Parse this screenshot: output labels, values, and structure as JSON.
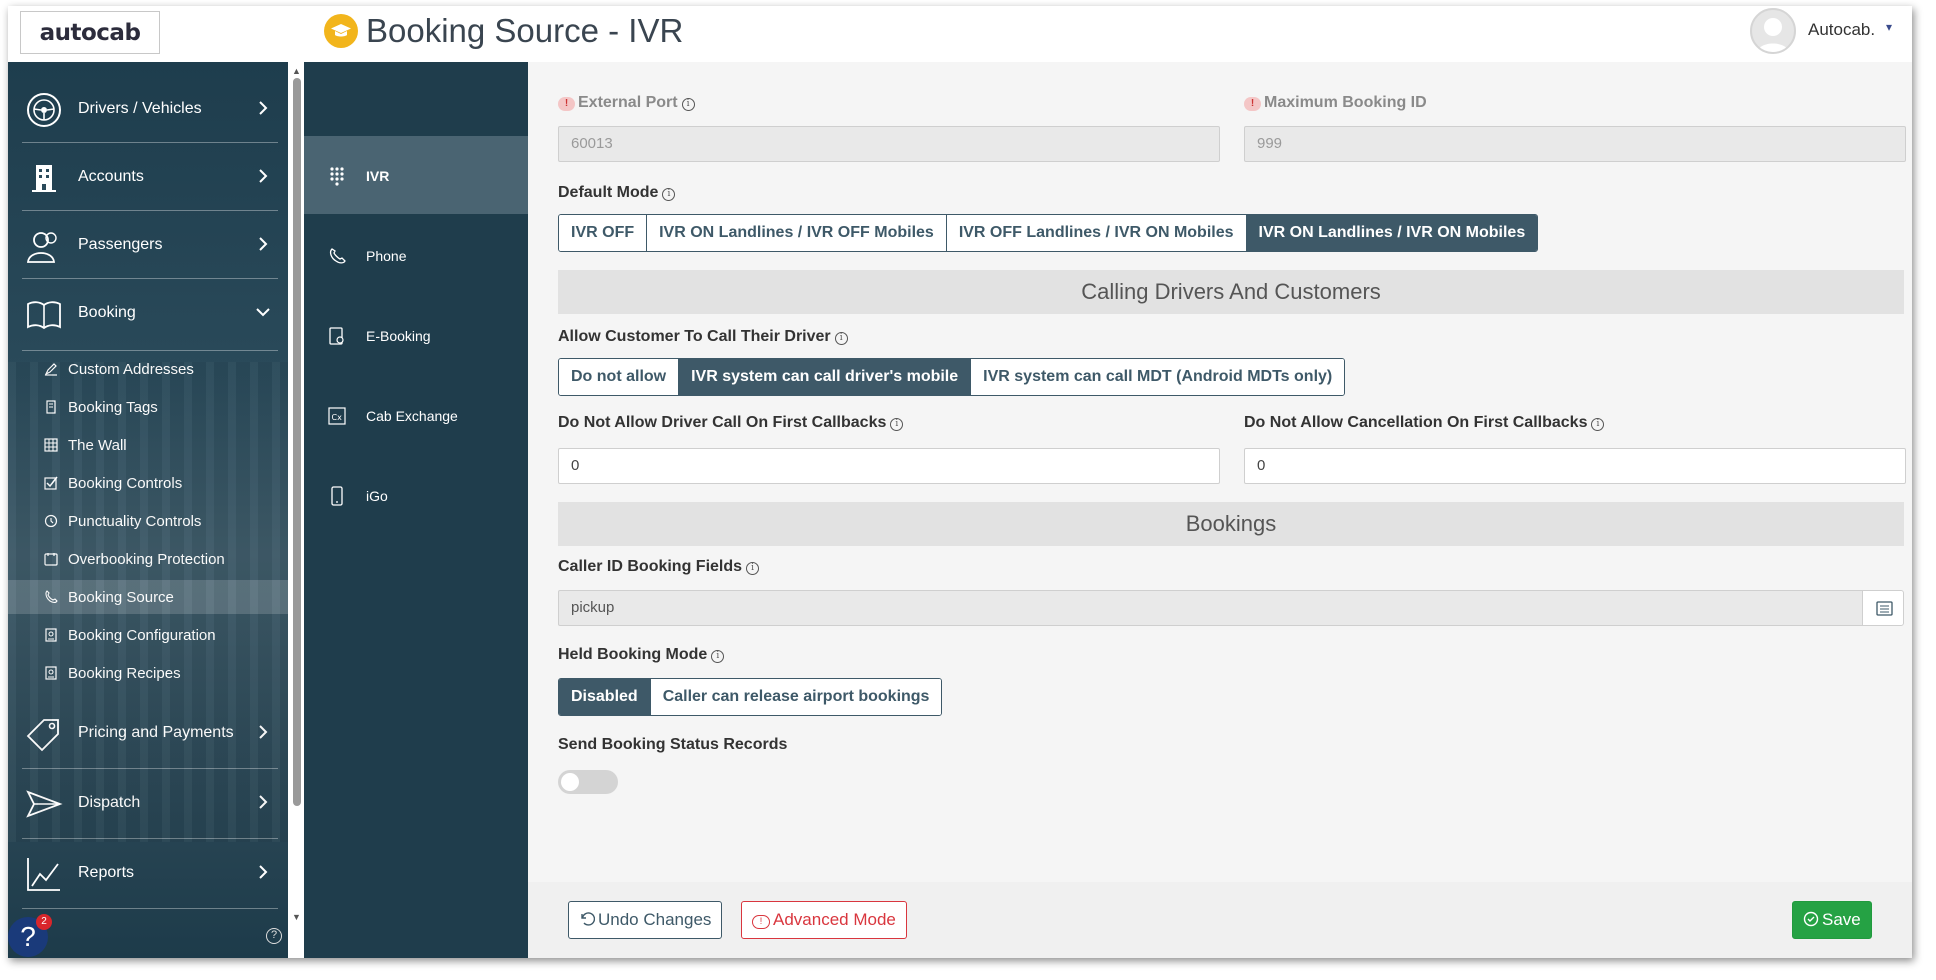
{
  "header": {
    "logo": "autocab",
    "title": "Booking Source - IVR",
    "user_name": "Autocab."
  },
  "sidebar": {
    "items": [
      {
        "label": "Drivers / Vehicles",
        "icon": "steering-wheel-icon"
      },
      {
        "label": "Accounts",
        "icon": "building-icon"
      },
      {
        "label": "Passengers",
        "icon": "people-icon"
      },
      {
        "label": "Booking",
        "icon": "book-icon"
      },
      {
        "label": "Pricing and Payments",
        "icon": "price-tag-icon"
      },
      {
        "label": "Dispatch",
        "icon": "send-icon"
      },
      {
        "label": "Reports",
        "icon": "chart-icon"
      }
    ],
    "booking_sub": [
      {
        "label": "Custom Addresses",
        "icon": "edit-icon"
      },
      {
        "label": "Booking Tags",
        "icon": "tag-icon"
      },
      {
        "label": "The Wall",
        "icon": "grid-icon"
      },
      {
        "label": "Booking Controls",
        "icon": "checkbox-icon"
      },
      {
        "label": "Punctuality Controls",
        "icon": "clock-icon"
      },
      {
        "label": "Overbooking Protection",
        "icon": "calendar-icon"
      },
      {
        "label": "Booking Source",
        "icon": "phone-icon"
      },
      {
        "label": "Booking Configuration",
        "icon": "config-icon"
      },
      {
        "label": "Booking Recipes",
        "icon": "recipe-icon"
      }
    ],
    "help_badge": "2"
  },
  "subnav": {
    "items": [
      {
        "label": "IVR",
        "icon": "dialpad-icon"
      },
      {
        "label": "Phone",
        "icon": "phone-icon"
      },
      {
        "label": "E-Booking",
        "icon": "tablet-icon"
      },
      {
        "label": "Cab Exchange",
        "icon": "cab-exchange-icon"
      },
      {
        "label": "iGo",
        "icon": "mobile-icon"
      }
    ]
  },
  "form": {
    "external_port": {
      "label": "External Port",
      "value": "60013"
    },
    "max_booking_id": {
      "label": "Maximum Booking ID",
      "value": "999"
    },
    "default_mode": {
      "label": "Default Mode",
      "options": [
        "IVR OFF",
        "IVR ON Landlines / IVR OFF Mobiles",
        "IVR OFF Landlines / IVR ON Mobiles",
        "IVR ON Landlines / IVR ON Mobiles"
      ],
      "selected": "IVR ON Landlines / IVR ON Mobiles"
    },
    "section_calling": "Calling Drivers And Customers",
    "allow_call": {
      "label": "Allow Customer To Call Their Driver",
      "options": [
        "Do not allow",
        "IVR system can call driver's mobile",
        "IVR system can call MDT (Android MDTs only)"
      ],
      "selected": "IVR system can call driver's mobile"
    },
    "no_driver_call": {
      "label": "Do Not Allow Driver Call On First Callbacks",
      "value": "0"
    },
    "no_cancel": {
      "label": "Do Not Allow Cancellation On First Callbacks",
      "value": "0"
    },
    "section_bookings": "Bookings",
    "caller_id": {
      "label": "Caller ID Booking Fields",
      "value": "pickup"
    },
    "held_mode": {
      "label": "Held Booking Mode",
      "options": [
        "Disabled",
        "Caller can release airport bookings"
      ],
      "selected": "Disabled"
    },
    "send_status": {
      "label": "Send Booking Status Records",
      "enabled": false
    }
  },
  "footer": {
    "undo": "Undo Changes",
    "advanced": "Advanced Mode",
    "save": "Save"
  },
  "colors": {
    "primary": "#3e5968",
    "sidebar": "#1f3d4c",
    "save": "#25a244",
    "danger": "#d9363e",
    "accent": "#f2b51c"
  }
}
